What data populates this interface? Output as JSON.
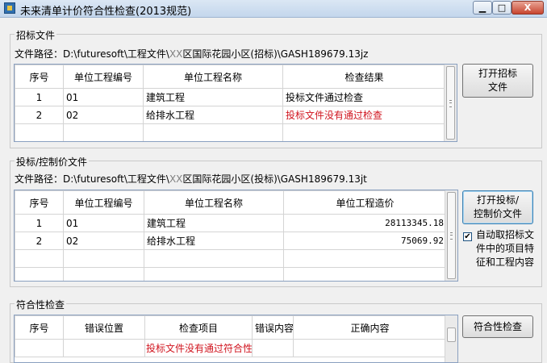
{
  "window": {
    "title": "未来清单计价符合性检查(2013规范)",
    "minimize": "▁",
    "maximize": "□",
    "close": "X"
  },
  "bid_section": {
    "title": "招标文件",
    "path_label": "文件路径：",
    "path_part1": "D:\\futuresoft\\工程文件\\",
    "path_gray": "XX",
    "path_part2": "区国际花园小区(招标)\\GASH189679.13jz",
    "columns": [
      "序号",
      "单位工程编号",
      "单位工程名称",
      "检查结果"
    ],
    "rows": [
      {
        "no": "1",
        "code": "01",
        "name": "建筑工程",
        "result": "投标文件通过检查"
      },
      {
        "no": "2",
        "code": "02",
        "name": "给排水工程",
        "result": "投标文件没有通过检查"
      }
    ],
    "open_button": "打开招标\n文件"
  },
  "tender_section": {
    "title": "投标/控制价文件",
    "path_label": "文件路径：",
    "path_part1": "D:\\futuresoft\\工程文件\\",
    "path_gray": "XX",
    "path_part2": "区国际花园小区(投标)\\GASH189679.13jt",
    "columns": [
      "序号",
      "单位工程编号",
      "单位工程名称",
      "单位工程造价"
    ],
    "rows": [
      {
        "no": "1",
        "code": "01",
        "name": "建筑工程",
        "price": "28113345.18"
      },
      {
        "no": "2",
        "code": "02",
        "name": "给排水工程",
        "price": "75069.92"
      }
    ],
    "open_button": "打开投标/\n控制价文件",
    "auto_checkbox_label": "自动取招标文件中的项目特征和工程内容",
    "auto_checked": true
  },
  "check_section": {
    "title": "符合性检查",
    "columns": [
      "序号",
      "错误位置",
      "检查项目",
      "错误内容",
      "正确内容"
    ],
    "rows": [
      {
        "no": "",
        "position": "",
        "item": "投标文件没有通过符合性",
        "error": "",
        "correct": ""
      }
    ],
    "check_button": "符合性检查"
  },
  "colors": {
    "error": "#d0141e",
    "grid_border": "#8aa0c0"
  }
}
